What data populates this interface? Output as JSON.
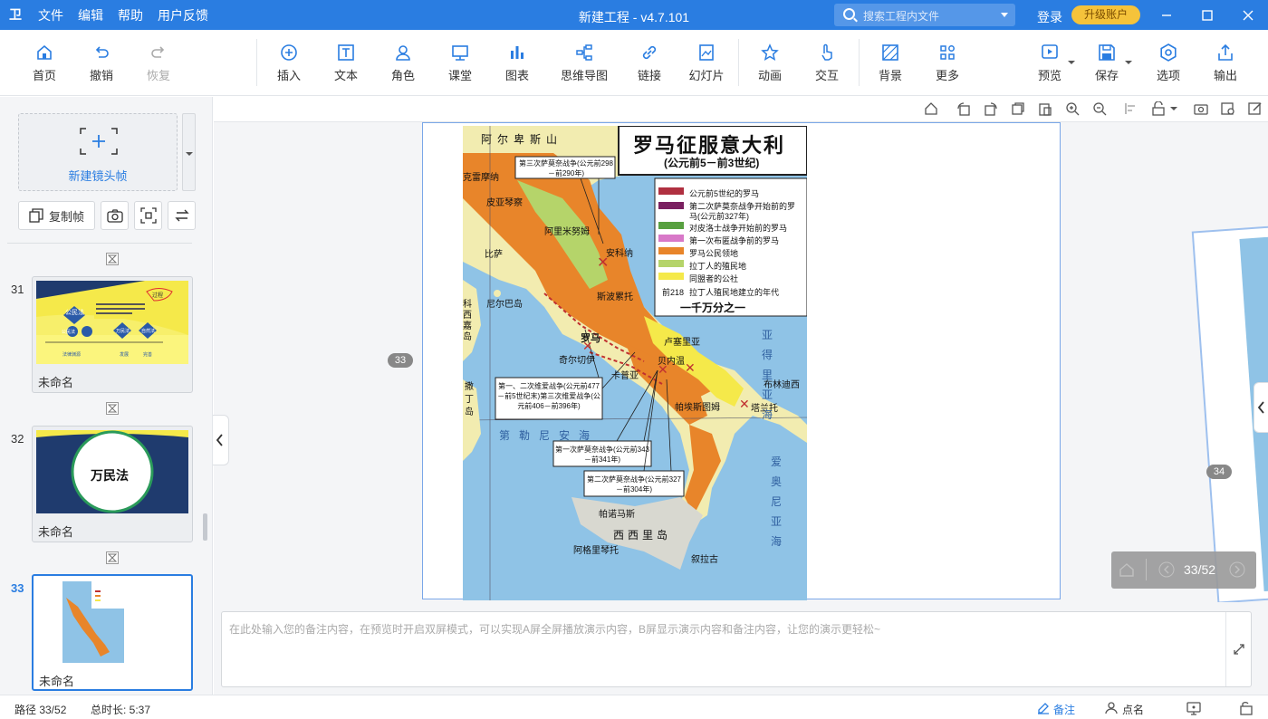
{
  "app": {
    "logo": "卫",
    "menu": [
      "文件",
      "编辑",
      "帮助",
      "用户反馈"
    ],
    "title": "新建工程 - v4.7.101",
    "search_placeholder": "搜索工程内文件",
    "login": "登录",
    "upgrade": "升级账户"
  },
  "toolbar": {
    "home": "首页",
    "undo": "撤销",
    "redo": "恢复",
    "insert": "插入",
    "text": "文本",
    "role": "角色",
    "classroom": "课堂",
    "chart": "图表",
    "mindmap": "思维导图",
    "link": "链接",
    "slideshow": "幻灯片",
    "animation": "动画",
    "interaction": "交互",
    "background": "背景",
    "more": "更多",
    "preview": "预览",
    "save": "保存",
    "options": "选项",
    "export": "输出"
  },
  "sidebar": {
    "new_frame": "新建镜头帧",
    "copy_frame": "复制帧",
    "frames": [
      {
        "num": "31",
        "name": "未命名"
      },
      {
        "num": "32",
        "name": "未命名",
        "title": "万民法"
      },
      {
        "num": "33",
        "name": "未命名"
      }
    ]
  },
  "thumb31": {
    "badge": "公民法",
    "tag": "过程",
    "items": [
      "法律渊源",
      "罗马法的",
      "公民法",
      "万民法",
      "自然法",
      "来源",
      "发展",
      "完善"
    ]
  },
  "canvas": {
    "current_badge": "33",
    "next_badge": "34",
    "pager": "33/52"
  },
  "map": {
    "title": "罗马征服意大利",
    "subtitle": "(公元前5－前3世纪)",
    "scale": "一千万分之一",
    "legend": [
      "公元前5世纪的罗马",
      "第二次萨莫奈战争开始前的罗马(公元前327年)",
      "对皮洛士战争开始前的罗马",
      "第一次布匿战争前的罗马",
      "罗马公民领地",
      "拉丁人的殖民地",
      "同盟者的公社",
      "拉丁人殖民地建立的年代"
    ],
    "legend_year": "前218",
    "labels": [
      "阿尔卑斯山",
      "克雷摩纳",
      "皮亚琴察",
      "阿里米努姆",
      "安科纳",
      "斯波累托",
      "比萨",
      "尼尔巴岛",
      "科西嘉岛",
      "撒丁岛",
      "第勒尼安海",
      "罗马",
      "奇尔切伊",
      "卡普亚",
      "贝内温",
      "卢塞里亚",
      "布林迪西",
      "塔兰托",
      "帕埃斯图姆",
      "西西里岛",
      "叙拉古",
      "阿格里琴托",
      "帕诺马斯",
      "爱奥尼亚海",
      "亚得里亚海"
    ],
    "callouts": [
      "第三次萨莫奈战争(公元前298－前290年)",
      "第一、二次维爱战争(公元前477－前5世纪末)第三次维爱战争(公元前406－前396年)",
      "第一次萨莫奈战争(公元前343－前341年)",
      "第二次萨莫奈战争(公元前327－前304年)"
    ]
  },
  "notes": {
    "placeholder": "在此处输入您的备注内容，在预览时开启双屏模式，可以实现A屏全屏播放演示内容，B屏显示演示内容和备注内容，让您的演示更轻松~"
  },
  "status": {
    "path": "路径 33/52",
    "duration": "总时长: 5:37",
    "notes_btn": "备注",
    "rollcall": "点名"
  },
  "colors": {
    "accent": "#2a7de1",
    "upgrade": "#f5c33b"
  }
}
